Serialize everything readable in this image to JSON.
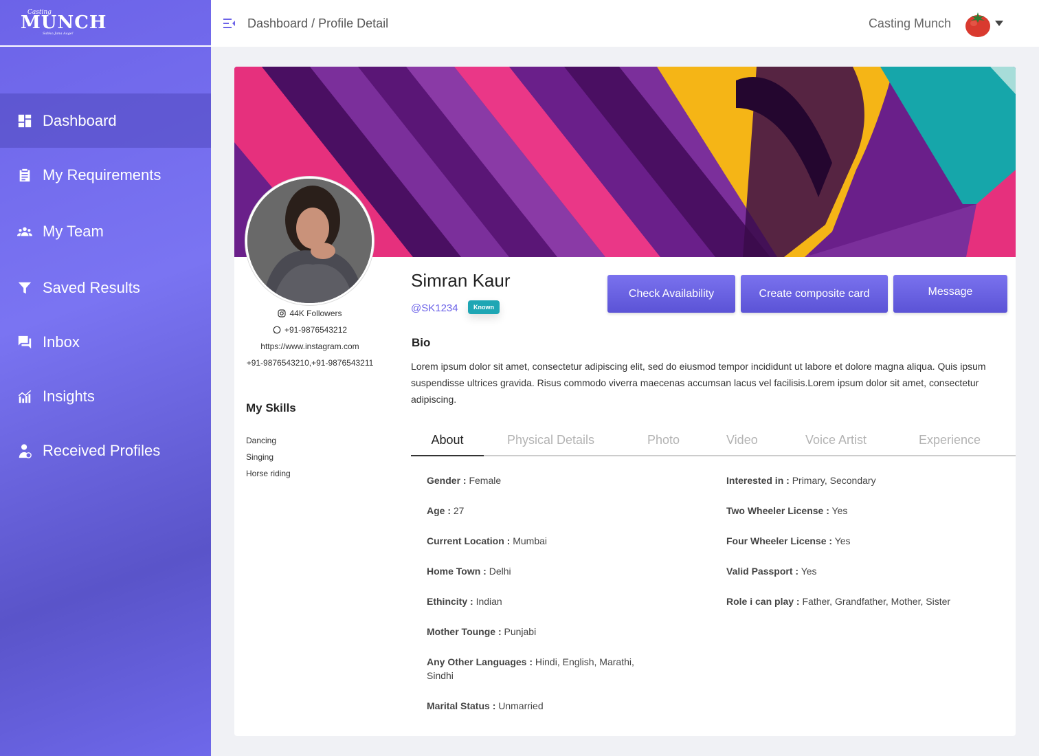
{
  "app": {
    "logo_pre": "Casting",
    "logo_main": "MUNCH",
    "logo_tag": "Sabko Jana Aage!"
  },
  "sidebar": {
    "items": [
      {
        "label": "Dashboard",
        "icon": "dashboard-icon",
        "active": true
      },
      {
        "label": "My Requirements",
        "icon": "clipboard-icon"
      },
      {
        "label": "My Team",
        "icon": "team-icon"
      },
      {
        "label": "Saved Results",
        "icon": "filter-icon"
      },
      {
        "label": "Inbox",
        "icon": "inbox-icon"
      },
      {
        "label": "Insights",
        "icon": "insights-icon"
      },
      {
        "label": "Received Profiles",
        "icon": "profile-user-icon"
      }
    ]
  },
  "header": {
    "breadcrumb_root": "Dashboard",
    "breadcrumb_sep": "/",
    "breadcrumb_current": "Profile Detail",
    "user_name": "Casting Munch"
  },
  "profile": {
    "name": "Simran Kaur",
    "handle": "@SK1234",
    "badge": "Known",
    "followers": "44K Followers",
    "whatsapp": "+91-9876543212",
    "website": "https://www.instagram.com",
    "phones": "+91-9876543210,+91-9876543211",
    "skills_title": "My Skills",
    "skills": [
      "Dancing",
      "Singing",
      "Horse riding"
    ],
    "bio_title": "Bio",
    "bio": "Lorem ipsum dolor sit amet, consectetur adipiscing elit, sed do eiusmod tempor incididunt ut labore et dolore magna aliqua. Quis ipsum suspendisse ultrices gravida. Risus commodo viverra maecenas accumsan lacus vel facilisis.Lorem ipsum dolor sit amet, consectetur adipiscing."
  },
  "actions": {
    "check_availability": "Check Availability",
    "create_card": "Create composite card",
    "message": "Message"
  },
  "tabs": [
    {
      "label": "About",
      "active": true
    },
    {
      "label": "Physical Details"
    },
    {
      "label": "Photo"
    },
    {
      "label": "Video"
    },
    {
      "label": "Voice Artist"
    },
    {
      "label": "Experience"
    }
  ],
  "about_left": [
    {
      "label": "Gender :",
      "value": "Female"
    },
    {
      "label": "Age :",
      "value": "27"
    },
    {
      "label": "Current Location :",
      "value": "Mumbai"
    },
    {
      "label": "Home Town :",
      "value": "Delhi"
    },
    {
      "label": "Ethincity :",
      "value": "Indian"
    },
    {
      "label": "Mother Tounge :",
      "value": "Punjabi"
    },
    {
      "label": "Any Other Languages :",
      "value": "Hindi, English, Marathi, Sindhi"
    },
    {
      "label": "Marital Status :",
      "value": "Unmarried"
    }
  ],
  "about_right": [
    {
      "label": "Interested in :",
      "value": "Primary, Secondary"
    },
    {
      "label": "Two Wheeler License :",
      "value": "Yes"
    },
    {
      "label": "Four Wheeler License :",
      "value": "Yes"
    },
    {
      "label": "Valid Passport :",
      "value": "Yes"
    },
    {
      "label": "Role i can play :",
      "value": "Father, Grandfather, Mother, Sister"
    }
  ],
  "colors": {
    "accent": "#6c63e8",
    "badge": "#1ea6b4"
  }
}
